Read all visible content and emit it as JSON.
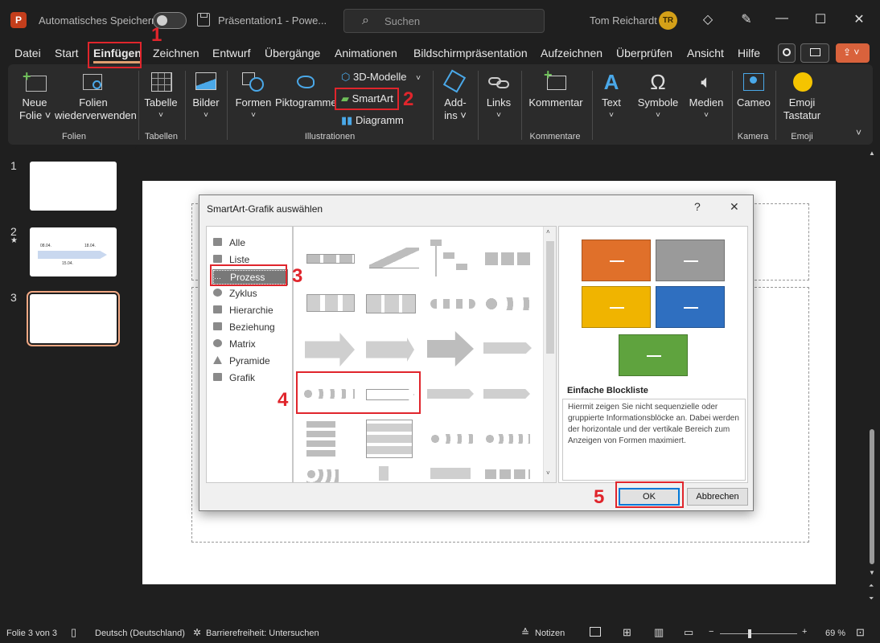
{
  "titlebar": {
    "autosave_label": "Automatisches Speichern",
    "document_title": "Präsentation1  -  Powe...",
    "search_placeholder": "Suchen",
    "user_name": "Tom Reichardt",
    "user_initials": "TR"
  },
  "menu": {
    "tabs": [
      "Datei",
      "Start",
      "Einfügen",
      "Zeichnen",
      "Entwurf",
      "Übergänge",
      "Animationen",
      "Bildschirmpräsentation",
      "Aufzeichnen",
      "Überprüfen",
      "Ansicht",
      "Hilfe"
    ],
    "active_tab": "Einfügen"
  },
  "ribbon": {
    "new_slide_1": "Neue",
    "new_slide_2": "Folie ˅",
    "reuse_1": "Folien",
    "reuse_2": "wiederverwenden",
    "table": "Tabelle",
    "pictures": "Bilder",
    "shapes": "Formen",
    "icons": "Piktogramme",
    "models3d": "3D-Modelle",
    "smartart": "SmartArt",
    "chart": "Diagramm",
    "addins_1": "Add-",
    "addins_2": "ins ˅",
    "links": "Links",
    "comment": "Kommentar",
    "text": "Text",
    "symbols": "Symbole",
    "media": "Medien",
    "cameo": "Cameo",
    "emoji_1": "Emoji",
    "emoji_2": "Tastatur",
    "groups": {
      "folien": "Folien",
      "tabellen": "Tabellen",
      "illustrationen": "Illustrationen",
      "kommentare": "Kommentare",
      "kamera": "Kamera",
      "emoji": "Emoji"
    }
  },
  "thumbnails": {
    "numbers": [
      "1",
      "2",
      "3"
    ],
    "slide2_star": "★",
    "slide2_dates": [
      "08.04.",
      "18.04.",
      "15.04."
    ]
  },
  "dialog": {
    "title": "SmartArt-Grafik auswählen",
    "help": "?",
    "close": "✕",
    "categories": [
      "Alle",
      "Liste",
      "Prozess",
      "Zyklus",
      "Hierarchie",
      "Beziehung",
      "Matrix",
      "Pyramide",
      "Grafik"
    ],
    "selected_category": "Prozess",
    "preview_title": "Einfache Blockliste",
    "preview_description": "Hiermit zeigen Sie nicht sequenzielle oder gruppierte Informationsblöcke an. Dabei werden der horizontale und der vertikale Bereich zum Anzeigen von Formen maximiert.",
    "ok": "OK",
    "cancel": "Abbrechen",
    "preview_colors": [
      "#e0702a",
      "#9a9a9a",
      "#f0b400",
      "#2f6fc0",
      "#5fa33e"
    ]
  },
  "annotations": [
    "1",
    "2",
    "3",
    "4",
    "5"
  ],
  "statusbar": {
    "slide_info": "Folie 3 von 3",
    "language": "Deutsch (Deutschland)",
    "accessibility": "Barrierefreiheit: Untersuchen",
    "notes": "Notizen",
    "zoom": "69 %"
  }
}
